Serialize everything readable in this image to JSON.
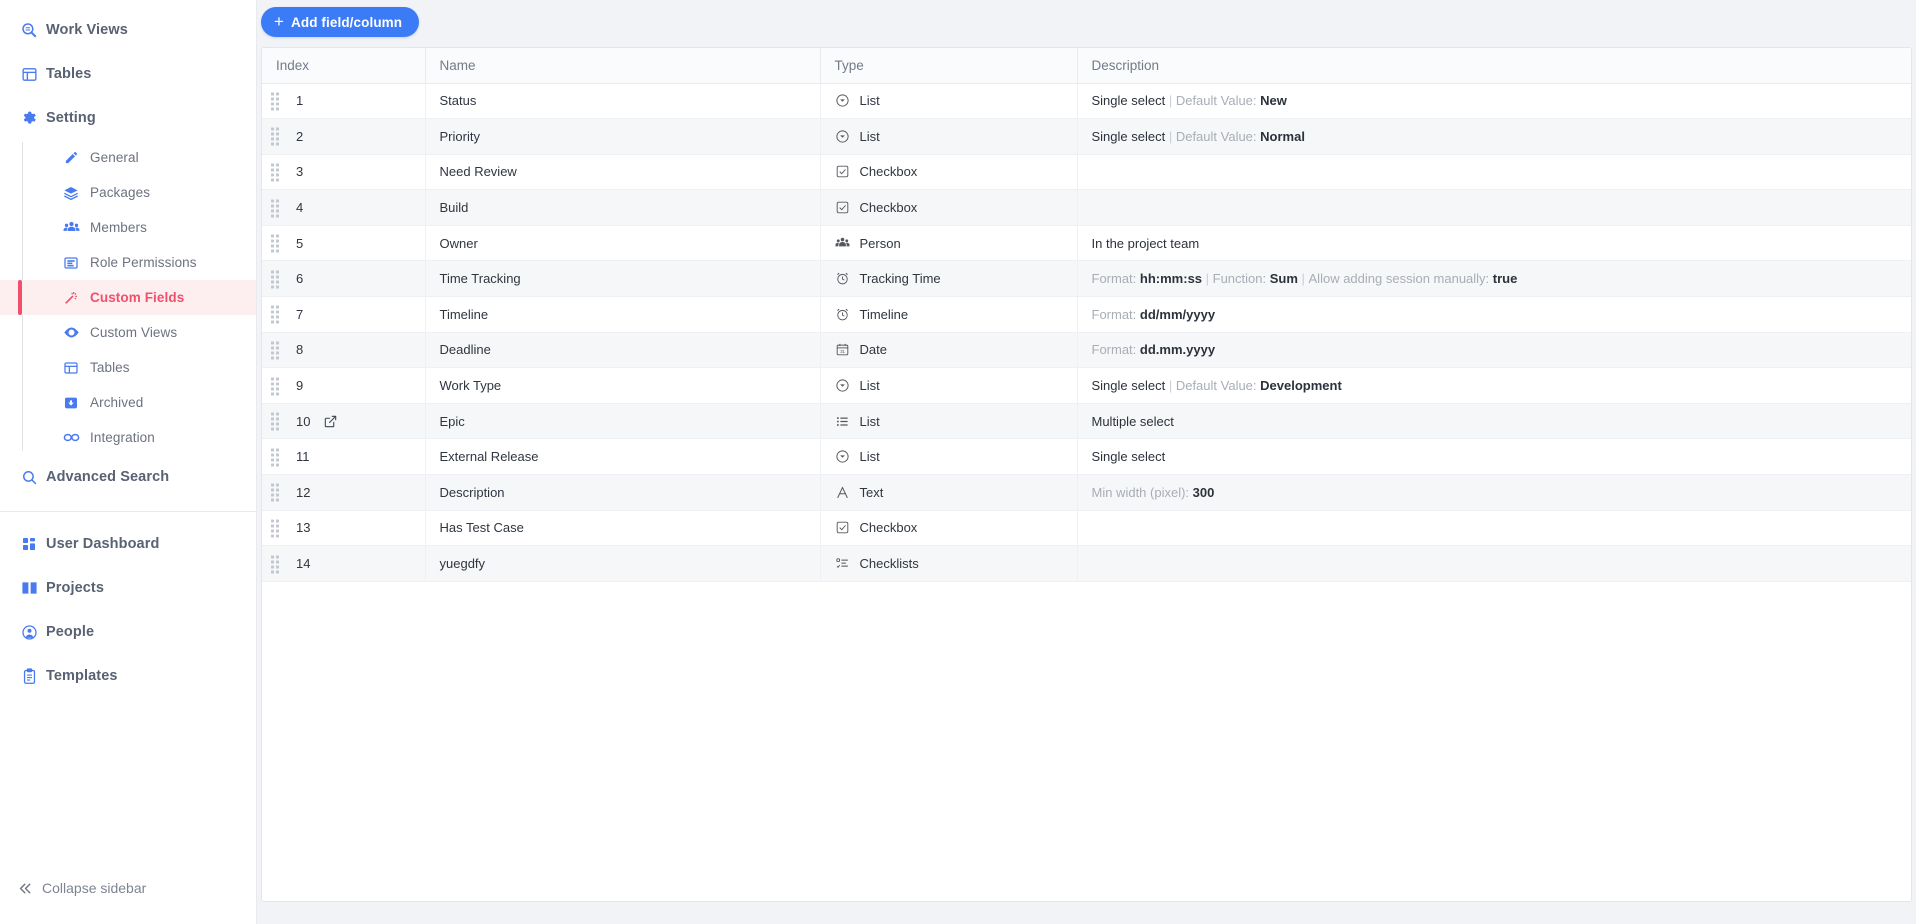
{
  "sidebar": {
    "top_items": [
      {
        "label": "Work Views",
        "icon": "search-views-icon"
      },
      {
        "label": "Tables",
        "icon": "table-icon"
      },
      {
        "label": "Setting",
        "icon": "gear-icon"
      }
    ],
    "setting_children": [
      {
        "label": "General",
        "icon": "pencil-icon",
        "active": false
      },
      {
        "label": "Packages",
        "icon": "layers-icon",
        "active": false
      },
      {
        "label": "Members",
        "icon": "people-icon",
        "active": false
      },
      {
        "label": "Role Permissions",
        "icon": "list-card-icon",
        "active": false
      },
      {
        "label": "Custom Fields",
        "icon": "magic-wand-icon",
        "active": true
      },
      {
        "label": "Custom Views",
        "icon": "eye-icon",
        "active": false
      },
      {
        "label": "Tables",
        "icon": "table-icon",
        "active": false
      },
      {
        "label": "Archived",
        "icon": "archive-icon",
        "active": false
      },
      {
        "label": "Integration",
        "icon": "link-icon",
        "active": false
      }
    ],
    "advanced_search": {
      "label": "Advanced Search",
      "icon": "search-icon"
    },
    "bottom_items": [
      {
        "label": "User Dashboard",
        "icon": "dashboard-icon"
      },
      {
        "label": "Projects",
        "icon": "book-icon"
      },
      {
        "label": "People",
        "icon": "person-icon"
      },
      {
        "label": "Templates",
        "icon": "clipboard-icon"
      }
    ],
    "collapse": {
      "label": "Collapse sidebar",
      "icon": "chevrons-left-icon"
    },
    "active_color": "#f1506b",
    "icon_color": "#4a7af0"
  },
  "toolbar": {
    "add_label": "Add field/column",
    "add_icon": "plus-icon",
    "accent": "#3c7bf6"
  },
  "table": {
    "columns": [
      "Index",
      "Name",
      "Type",
      "Description"
    ],
    "rows": [
      {
        "index": "1",
        "has_link": false,
        "name": "Status",
        "type": "List",
        "type_icon": "dropdown-circle-icon",
        "desc": [
          {
            "t": "Single select",
            "s": "plain"
          },
          {
            "t": " | ",
            "s": "sep"
          },
          {
            "t": "Default Value: ",
            "s": "dim"
          },
          {
            "t": "New",
            "s": "strong"
          }
        ]
      },
      {
        "index": "2",
        "has_link": false,
        "name": "Priority",
        "type": "List",
        "type_icon": "dropdown-circle-icon",
        "desc": [
          {
            "t": "Single select",
            "s": "plain"
          },
          {
            "t": " | ",
            "s": "sep"
          },
          {
            "t": "Default Value: ",
            "s": "dim"
          },
          {
            "t": "Normal",
            "s": "strong"
          }
        ]
      },
      {
        "index": "3",
        "has_link": false,
        "name": "Need Review",
        "type": "Checkbox",
        "type_icon": "checkbox-icon",
        "desc": []
      },
      {
        "index": "4",
        "has_link": false,
        "name": "Build",
        "type": "Checkbox",
        "type_icon": "checkbox-icon",
        "desc": []
      },
      {
        "index": "5",
        "has_link": false,
        "name": "Owner",
        "type": "Person",
        "type_icon": "people-icon",
        "desc": [
          {
            "t": "In the project team",
            "s": "plain"
          }
        ]
      },
      {
        "index": "6",
        "has_link": false,
        "name": "Time Tracking",
        "type": "Tracking Time",
        "type_icon": "clock-icon",
        "desc": [
          {
            "t": "Format: ",
            "s": "dim"
          },
          {
            "t": "hh:mm:ss",
            "s": "strong"
          },
          {
            "t": " | ",
            "s": "sep"
          },
          {
            "t": "Function: ",
            "s": "dim"
          },
          {
            "t": "Sum",
            "s": "strong"
          },
          {
            "t": " | ",
            "s": "sep"
          },
          {
            "t": "Allow adding session manually: ",
            "s": "dim"
          },
          {
            "t": "true",
            "s": "strong"
          }
        ]
      },
      {
        "index": "7",
        "has_link": false,
        "name": "Timeline",
        "type": "Timeline",
        "type_icon": "clock-icon",
        "desc": [
          {
            "t": "Format: ",
            "s": "dim"
          },
          {
            "t": "dd/mm/yyyy",
            "s": "strong"
          }
        ]
      },
      {
        "index": "8",
        "has_link": false,
        "name": "Deadline",
        "type": "Date",
        "type_icon": "calendar-icon",
        "desc": [
          {
            "t": "Format: ",
            "s": "dim"
          },
          {
            "t": "dd.mm.yyyy",
            "s": "strong"
          }
        ]
      },
      {
        "index": "9",
        "has_link": false,
        "name": "Work Type",
        "type": "List",
        "type_icon": "dropdown-circle-icon",
        "desc": [
          {
            "t": "Single select",
            "s": "plain"
          },
          {
            "t": " | ",
            "s": "sep"
          },
          {
            "t": "Default Value: ",
            "s": "dim"
          },
          {
            "t": "Development",
            "s": "strong"
          }
        ]
      },
      {
        "index": "10",
        "has_link": true,
        "name": "Epic",
        "type": "List",
        "type_icon": "bullet-list-icon",
        "desc": [
          {
            "t": "Multiple select",
            "s": "plain"
          }
        ]
      },
      {
        "index": "11",
        "has_link": false,
        "name": "External Release",
        "type": "List",
        "type_icon": "dropdown-circle-icon",
        "desc": [
          {
            "t": "Single select",
            "s": "plain"
          }
        ]
      },
      {
        "index": "12",
        "has_link": false,
        "name": "Description",
        "type": "Text",
        "type_icon": "text-a-icon",
        "desc": [
          {
            "t": "Min width (pixel): ",
            "s": "dim"
          },
          {
            "t": "300",
            "s": "strong"
          }
        ]
      },
      {
        "index": "13",
        "has_link": false,
        "name": "Has Test Case",
        "type": "Checkbox",
        "type_icon": "checkbox-icon",
        "desc": []
      },
      {
        "index": "14",
        "has_link": false,
        "name": "yuegdfy",
        "type": "Checklists",
        "type_icon": "checklist-icon",
        "desc": []
      }
    ]
  }
}
